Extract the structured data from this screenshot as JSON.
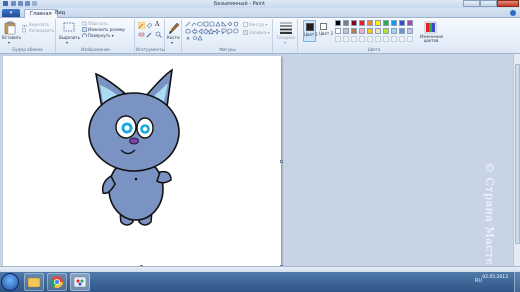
{
  "window": {
    "title": "Безымянный - Paint"
  },
  "ribbon": {
    "file_tab": "▾",
    "tabs": [
      {
        "label": "Главная",
        "active": true
      },
      {
        "label": "Вид",
        "active": false
      }
    ],
    "clipboard": {
      "paste": "Вставить",
      "cut": "Вырезать",
      "copy": "Копировать",
      "group_label": "Буфер обмена"
    },
    "image": {
      "select": "Выделить",
      "crop": "Обрезать",
      "resize": "Изменить размер",
      "rotate": "Повернуть ▾",
      "group_label": "Изображение"
    },
    "tools": {
      "group_label": "Инструменты"
    },
    "brushes": {
      "label": "Кисти"
    },
    "shapes": {
      "outline": "Контур ▾",
      "fill": "Заливка ▾",
      "group_label": "Фигуры"
    },
    "size": {
      "label": "Толщина"
    },
    "colors": {
      "color1_label": "Цвет 1",
      "color2_label": "Цвет 2",
      "edit_label": "Изменение цветов",
      "group_label": "Цвета",
      "color1": "#1e1e1e",
      "color2": "#ffffff",
      "palette": [
        "#000000",
        "#7f7f7f",
        "#880015",
        "#ed1c24",
        "#ff7f27",
        "#fff200",
        "#22b14c",
        "#00a2e8",
        "#3f48cc",
        "#a349a4",
        "#ffffff",
        "#c3c3c3",
        "#b97a57",
        "#ffaec9",
        "#ffc90e",
        "#efe4b0",
        "#b5e61d",
        "#99d9ea",
        "#7092be",
        "#c8bfe7"
      ]
    }
  },
  "canvas": {
    "background": "#ffffff",
    "cat_body_color": "#7b93c3",
    "cat_ear_inner": "#a9dcf2",
    "cat_eye_color": "#19a8e0",
    "cat_nose_color": "#7f3fb0"
  },
  "watermark": {
    "text": "© Страна Мастеров"
  },
  "taskbar": {
    "clock_time": "",
    "clock_date": "02.05.2013",
    "language": "RU"
  }
}
